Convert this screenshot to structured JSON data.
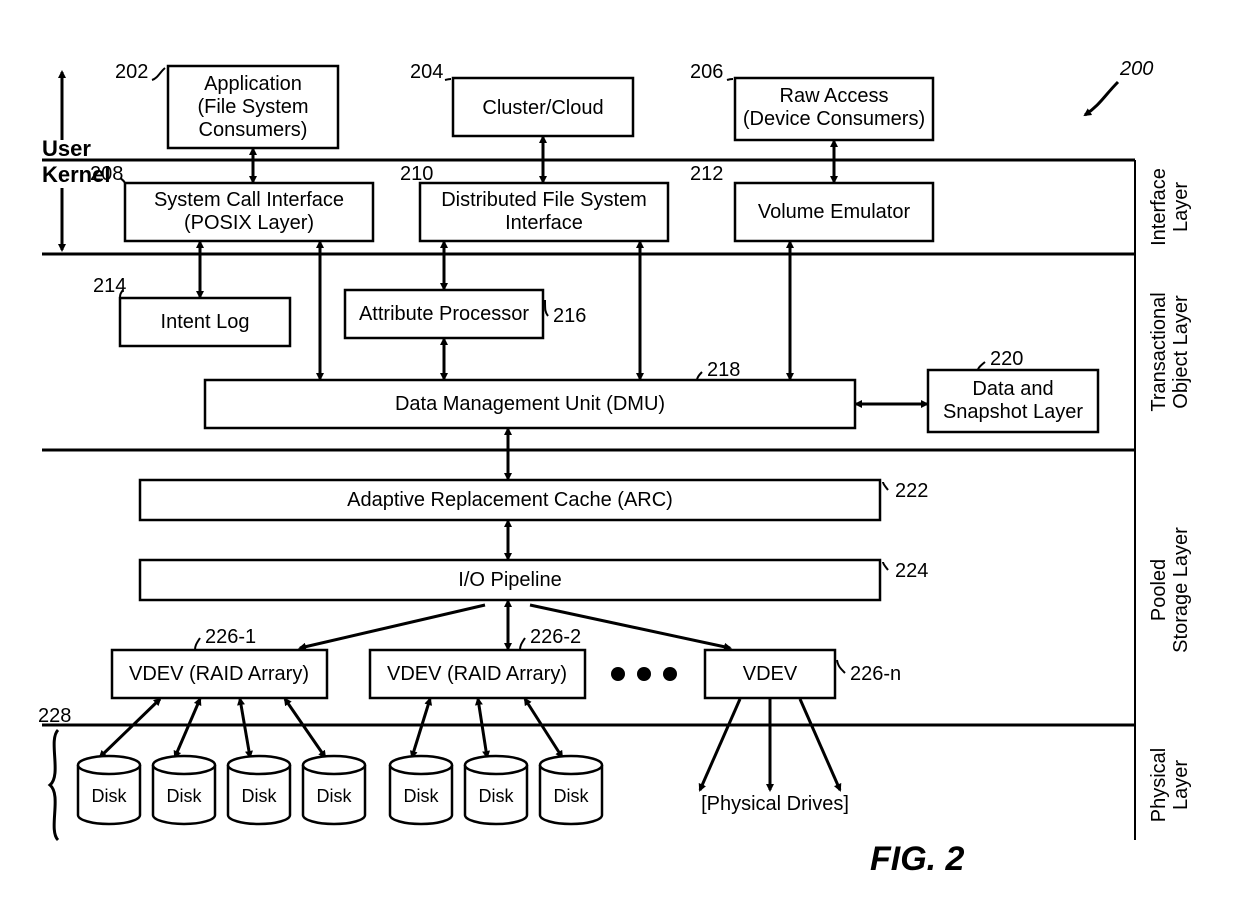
{
  "figure_label": "FIG. 2",
  "figure_ref": "200",
  "space_labels": {
    "user": "User",
    "kernel": "Kernel"
  },
  "layer_labels": {
    "interface": "Interface\nLayer",
    "trans": "Transactional\nObject Layer",
    "pooled": "Pooled\nStorage Layer",
    "phys": "Physical\nLayer"
  },
  "refs": {
    "app": "202",
    "cluster": "204",
    "raw": "206",
    "scall": "208",
    "dfs": "210",
    "vol": "212",
    "intent": "214",
    "attr": "216",
    "dmu": "218",
    "snap": "220",
    "arc": "222",
    "io": "224",
    "vdev1": "226-1",
    "vdev2": "226-2",
    "vdevn": "226-n",
    "disks": "228"
  },
  "boxes": {
    "app": "Application\n(File System\nConsumers)",
    "cluster": "Cluster/Cloud",
    "raw": "Raw Access\n(Device Consumers)",
    "scall": "System Call Interface\n(POSIX Layer)",
    "dfs": "Distributed File System\nInterface",
    "vol": "Volume Emulator",
    "intent": "Intent Log",
    "attr": "Attribute Processor",
    "dmu": "Data Management Unit (DMU)",
    "snap": "Data and\nSnapshot Layer",
    "arc": "Adaptive Replacement Cache (ARC)",
    "io": "I/O Pipeline",
    "vdev1": "VDEV (RAID Arrary)",
    "vdev2": "VDEV (RAID Arrary)",
    "vdevn": "VDEV"
  },
  "disk_label": "Disk",
  "physical_drives": "[Physical Drives]"
}
